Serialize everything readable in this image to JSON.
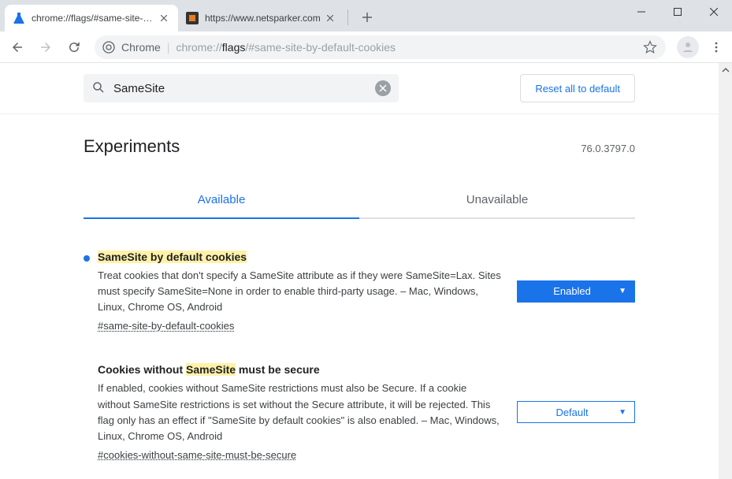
{
  "window": {
    "tabs": [
      {
        "title": "chrome://flags/#same-site-by-de"
      },
      {
        "title": "https://www.netsparker.com"
      }
    ]
  },
  "omnibox": {
    "chrome_label": "Chrome",
    "url_prefix": "chrome://",
    "url_bold": "flags",
    "url_suffix": "/#same-site-by-default-cookies"
  },
  "search": {
    "value": "SameSite"
  },
  "reset_label": "Reset all to default",
  "experiments_title": "Experiments",
  "version": "76.0.3797.0",
  "tabs": {
    "available": "Available",
    "unavailable": "Unavailable"
  },
  "flags": [
    {
      "modified": true,
      "title_hl": "SameSite by default cookies",
      "title_rest": "",
      "desc": "Treat cookies that don't specify a SameSite attribute as if they were SameSite=Lax. Sites must specify SameSite=None in order to enable third-party usage. – Mac, Windows, Linux, Chrome OS, Android",
      "anchor": "#same-site-by-default-cookies",
      "select_value": "Enabled",
      "select_filled": true
    },
    {
      "modified": false,
      "title_pre": "Cookies without ",
      "title_hl": "SameSite",
      "title_rest": " must be secure",
      "desc": "If enabled, cookies without SameSite restrictions must also be Secure. If a cookie without SameSite restrictions is set without the Secure attribute, it will be rejected. This flag only has an effect if \"SameSite by default cookies\" is also enabled. – Mac, Windows, Linux, Chrome OS, Android",
      "anchor": "#cookies-without-same-site-must-be-secure",
      "select_value": "Default",
      "select_filled": false
    }
  ]
}
